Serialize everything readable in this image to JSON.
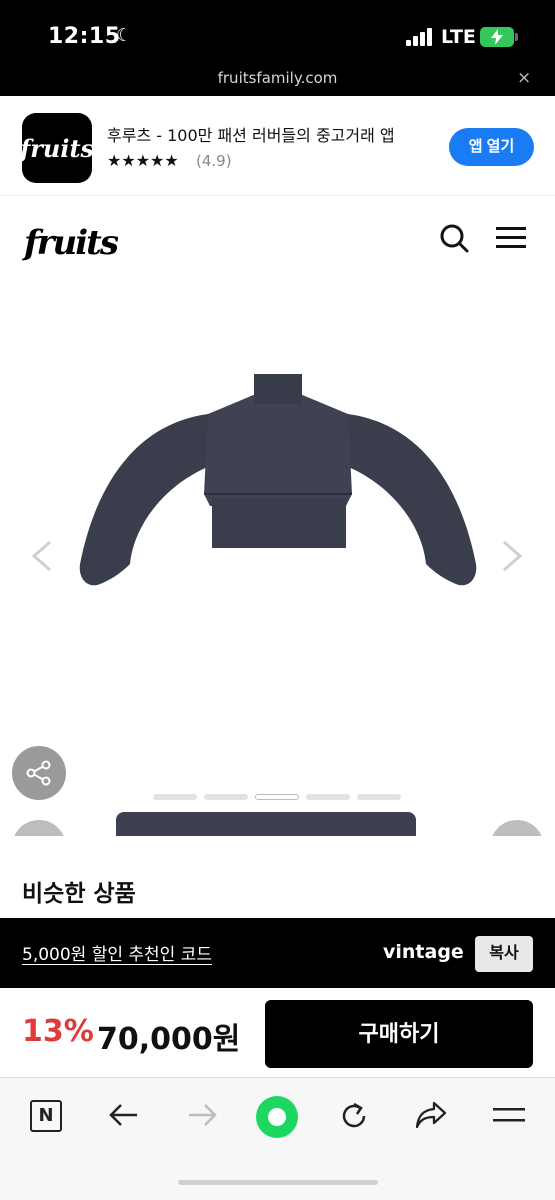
{
  "status_bar": {
    "time": "12:15",
    "network": "LTE",
    "battery_color": "#34c759"
  },
  "browser": {
    "url": "fruitsfamily.com",
    "close_icon": "×"
  },
  "app_banner": {
    "app_name_title": "후루츠 - 100만 패션 러버들의 중고거래 앱",
    "stars": "★★★★★",
    "rating": "(4.9)",
    "open_button": "앱 열기",
    "button_color": "#1a7cf5"
  },
  "site_header": {
    "logo_text": "fruits"
  },
  "gallery": {
    "slide_count": 5,
    "active_slide": 3
  },
  "similar": {
    "heading": "비슷한 상품"
  },
  "promo": {
    "code_text": "5,000원 할인 추천인 코드",
    "code_value": "vintage",
    "copy_button": "복사"
  },
  "purchase": {
    "discount": "13%",
    "price": "70,000원",
    "buy_button": "구매하기",
    "discount_color": "#e03a3a"
  },
  "toolbar": {
    "naver_label": "N",
    "home_color": "#1ed760"
  }
}
